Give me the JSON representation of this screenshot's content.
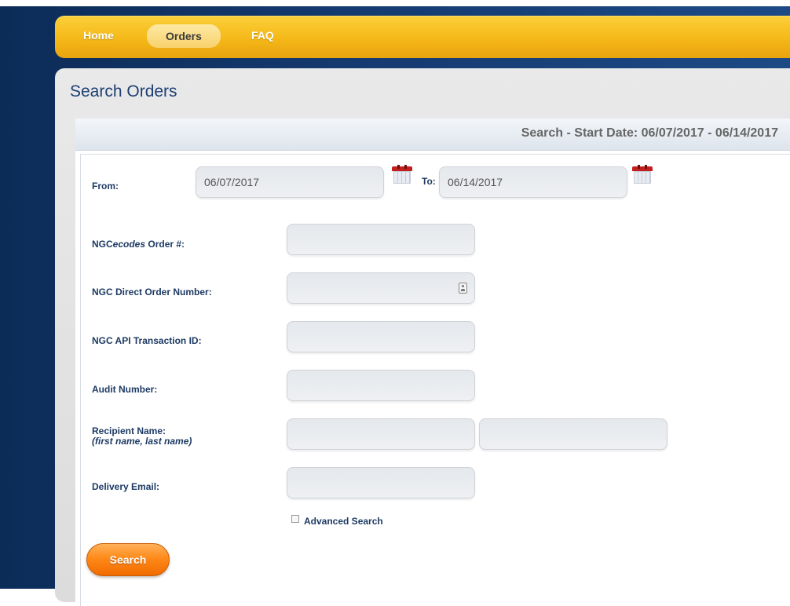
{
  "nav": {
    "items": [
      {
        "label": "Home"
      },
      {
        "label": "Orders",
        "active": true
      },
      {
        "label": "FAQ"
      }
    ]
  },
  "page": {
    "title": "Search Orders",
    "summary": "Search - Start Date: 06/07/2017 - 06/14/2017"
  },
  "form": {
    "from_label": "From:",
    "from_value": "06/07/2017",
    "to_label": "To:",
    "to_value": "06/14/2017",
    "ngc_ecodes_prefix": "NGC",
    "ngc_ecodes_italic": "ecodes",
    "ngc_ecodes_suffix": " Order #:",
    "ngc_ecodes_value": "",
    "direct_order_label": "NGC Direct Order Number:",
    "direct_order_value": "",
    "api_txn_label": "NGC API Transaction ID:",
    "api_txn_value": "",
    "audit_label": "Audit Number:",
    "audit_value": "",
    "recipient_label": "Recipient Name:",
    "recipient_hint": "(first name, last name)",
    "recipient_first_value": "",
    "recipient_last_value": "",
    "email_label": "Delivery Email:",
    "email_value": "",
    "advanced_search_label": "Advanced Search",
    "advanced_search_checked": false
  },
  "actions": {
    "search_label": "Search"
  },
  "colors": {
    "nav_accent": "#f5b818",
    "search_button": "#ff8a1a",
    "title_text": "#1d3f73",
    "calendar_red": "#c41f1f"
  },
  "icons": [
    "calendar-icon",
    "contact-card-icon"
  ]
}
